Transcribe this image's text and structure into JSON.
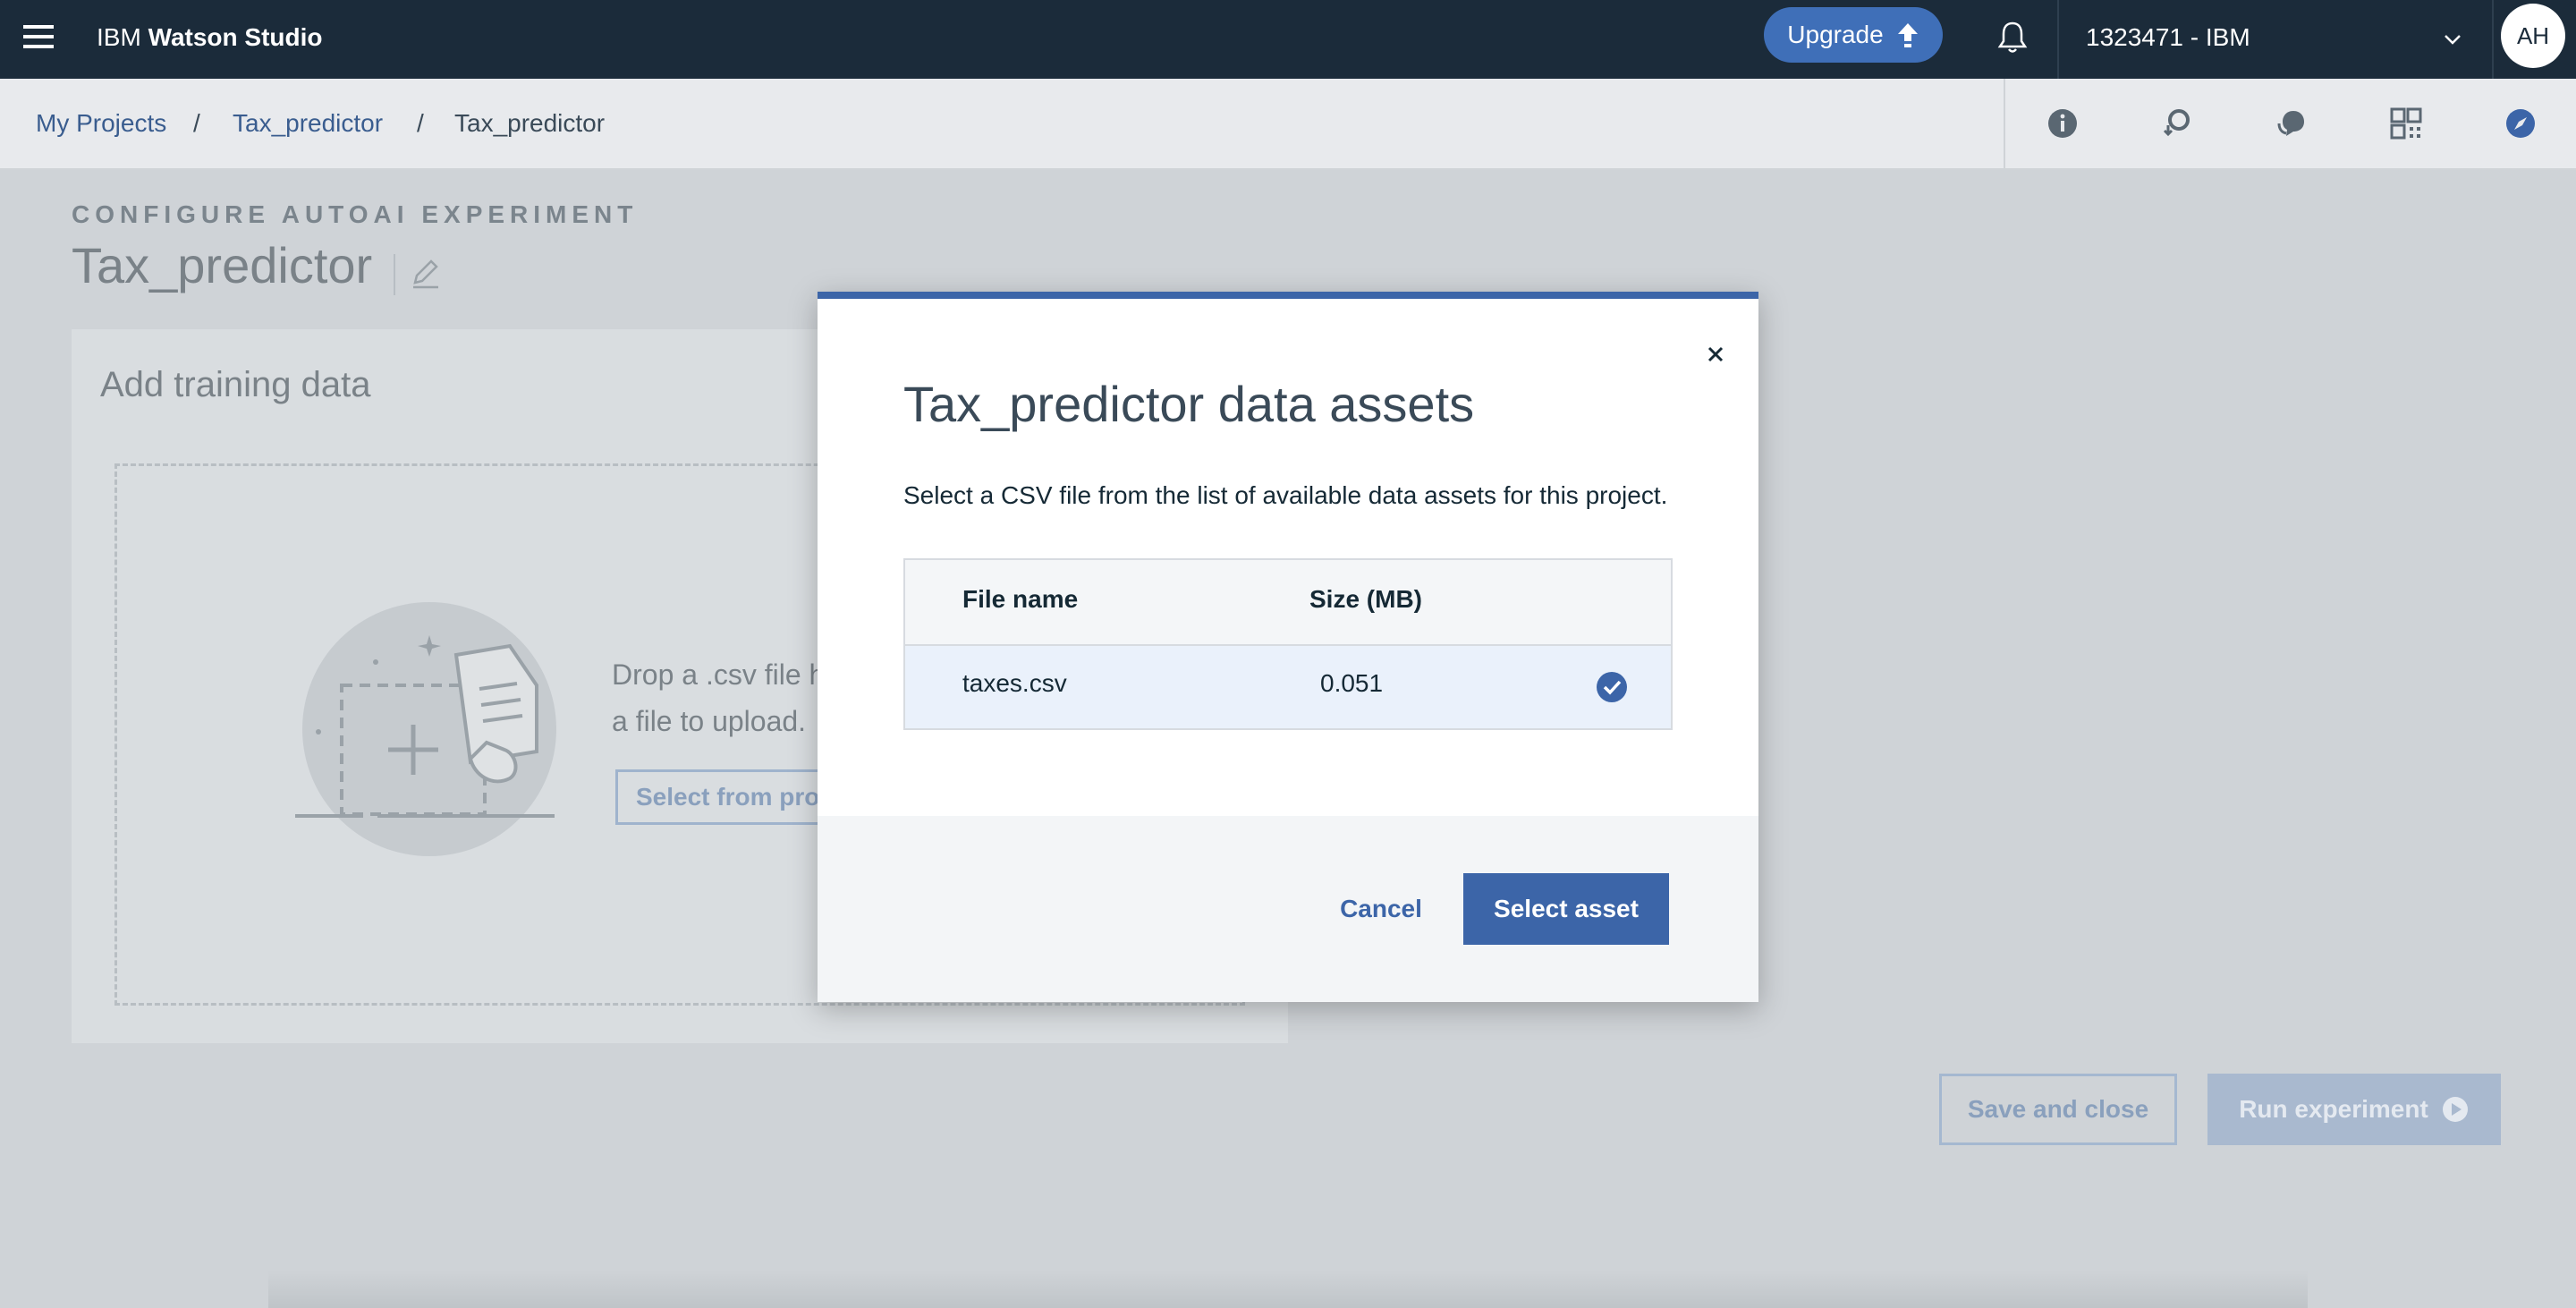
{
  "header": {
    "brand_prefix": "IBM",
    "brand_name": "Watson Studio",
    "upgrade_label": "Upgrade",
    "account_label": "1323471 - IBM",
    "avatar_initials": "AH"
  },
  "breadcrumb": {
    "items": [
      "My Projects",
      "Tax_predictor",
      "Tax_predictor"
    ],
    "separator": "/"
  },
  "toolbar_icons": [
    "info-icon",
    "history-icon",
    "chat-icon",
    "grid-icon",
    "compass-icon"
  ],
  "page": {
    "eyebrow": "CONFIGURE AUTOAI EXPERIMENT",
    "title": "Tax_predictor",
    "card_title": "Add training data",
    "drop_text_line1": "Drop a .csv file h",
    "drop_text_line2": "a file to upload.",
    "select_from_project_label": "Select from proj",
    "save_close_label": "Save and close",
    "run_label": "Run experiment"
  },
  "modal": {
    "title": "Tax_predictor data assets",
    "description": "Select a CSV file from the list of available data assets for this project.",
    "columns": [
      "File name",
      "Size (MB)"
    ],
    "rows": [
      {
        "file_name": "taxes.csv",
        "size": "0.051",
        "selected": true
      }
    ],
    "cancel_label": "Cancel",
    "select_label": "Select asset"
  },
  "colors": {
    "topbar": "#1b2b3a",
    "accent": "#3c65a8",
    "upgrade": "#3f6fb8",
    "selected_row": "#eaf1fb"
  }
}
